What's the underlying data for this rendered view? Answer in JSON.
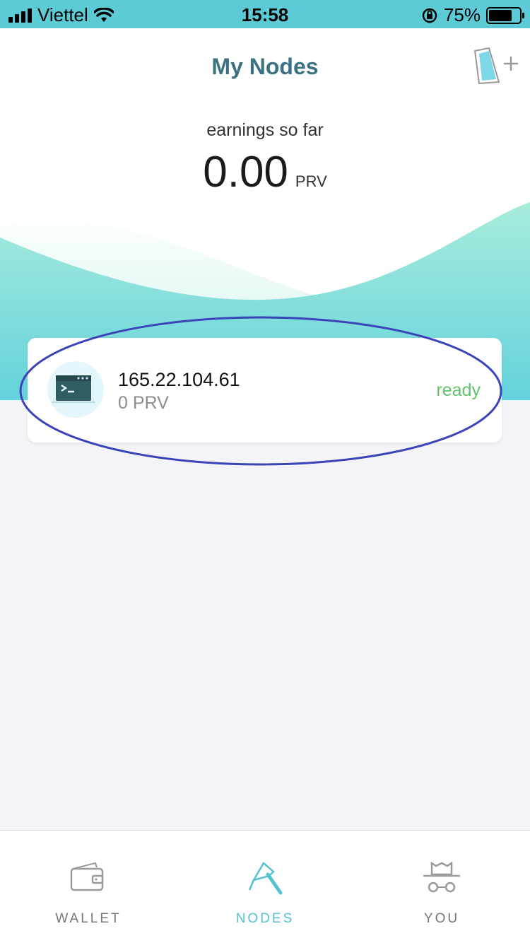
{
  "status_bar": {
    "carrier": "Viettel",
    "time": "15:58",
    "battery": "75%",
    "battery_level": 0.75
  },
  "header": {
    "title": "My Nodes",
    "add_node_icon": "add-device-icon"
  },
  "earnings": {
    "label": "earnings so far",
    "value": "0.00",
    "unit": "PRV"
  },
  "nodes": [
    {
      "ip": "165.22.104.61",
      "balance": "0 PRV",
      "status": "ready",
      "icon": "terminal-icon"
    }
  ],
  "tabs": [
    {
      "label": "WALLET",
      "icon": "wallet-icon",
      "active": false
    },
    {
      "label": "NODES",
      "icon": "pickaxe-icon",
      "active": true
    },
    {
      "label": "YOU",
      "icon": "incognito-icon",
      "active": false
    }
  ],
  "colors": {
    "accent": "#5ccbd6",
    "title": "#3b7283",
    "status_ready": "#63c36b",
    "highlight": "#3a43b8"
  }
}
